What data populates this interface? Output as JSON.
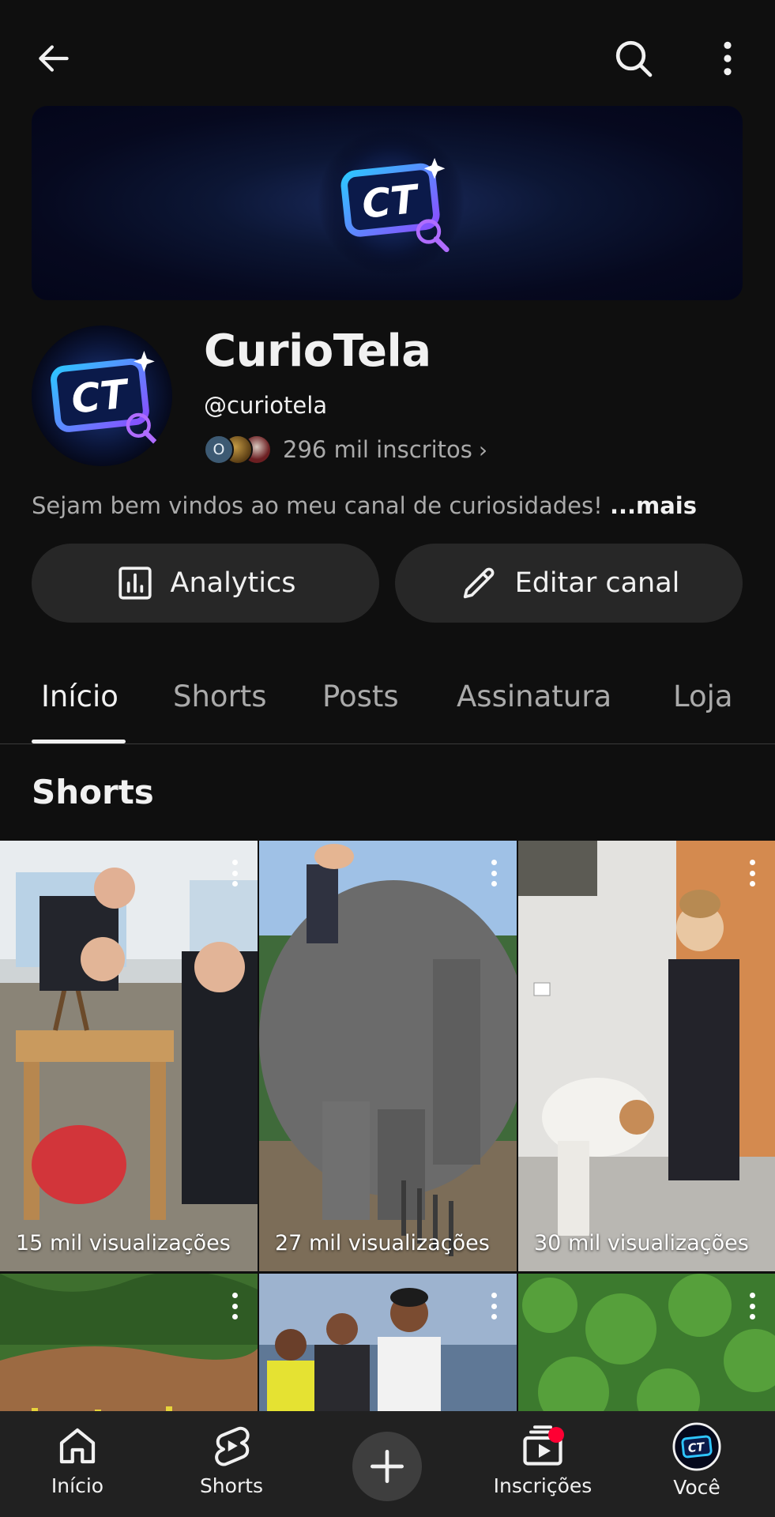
{
  "topbar": {
    "back_icon": "arrow-left-icon",
    "search_icon": "search-icon",
    "more_icon": "more-vert-icon"
  },
  "channel": {
    "name": "CurioTela",
    "handle": "@curiotela",
    "subscriber_avatar_initial": "O",
    "subscribers": "296 mil inscritos",
    "subscribers_chevron": "›",
    "description": "Sejam bem vindos ao meu canal de curiosidades!",
    "description_more": "...mais",
    "logo_text": "CT"
  },
  "actions": {
    "analytics_label": "Analytics",
    "edit_label": "Editar canal"
  },
  "tabs": [
    {
      "label": "Início",
      "active": true
    },
    {
      "label": "Shorts",
      "active": false
    },
    {
      "label": "Posts",
      "active": false
    },
    {
      "label": "Assinatura",
      "active": false
    },
    {
      "label": "Loja",
      "active": false
    }
  ],
  "section": {
    "title": "Shorts"
  },
  "shorts": [
    {
      "views": "15 mil visualizações"
    },
    {
      "views": "27 mil visualizações"
    },
    {
      "views": "30 mil visualizações"
    },
    {
      "views": ""
    },
    {
      "views": ""
    },
    {
      "views": ""
    }
  ],
  "bottom_nav": [
    {
      "label": "Início",
      "icon": "home-icon"
    },
    {
      "label": "Shorts",
      "icon": "shorts-icon"
    },
    {
      "label": "",
      "icon": "plus-icon"
    },
    {
      "label": "Inscrições",
      "icon": "subscriptions-icon"
    },
    {
      "label": "Você",
      "icon": "avatar-icon"
    }
  ],
  "colors": {
    "background": "#0f0f0f",
    "button_bg": "#272727",
    "secondary_text": "#aaaaaa",
    "nav_bg": "#212121",
    "notification": "#ff0033"
  }
}
